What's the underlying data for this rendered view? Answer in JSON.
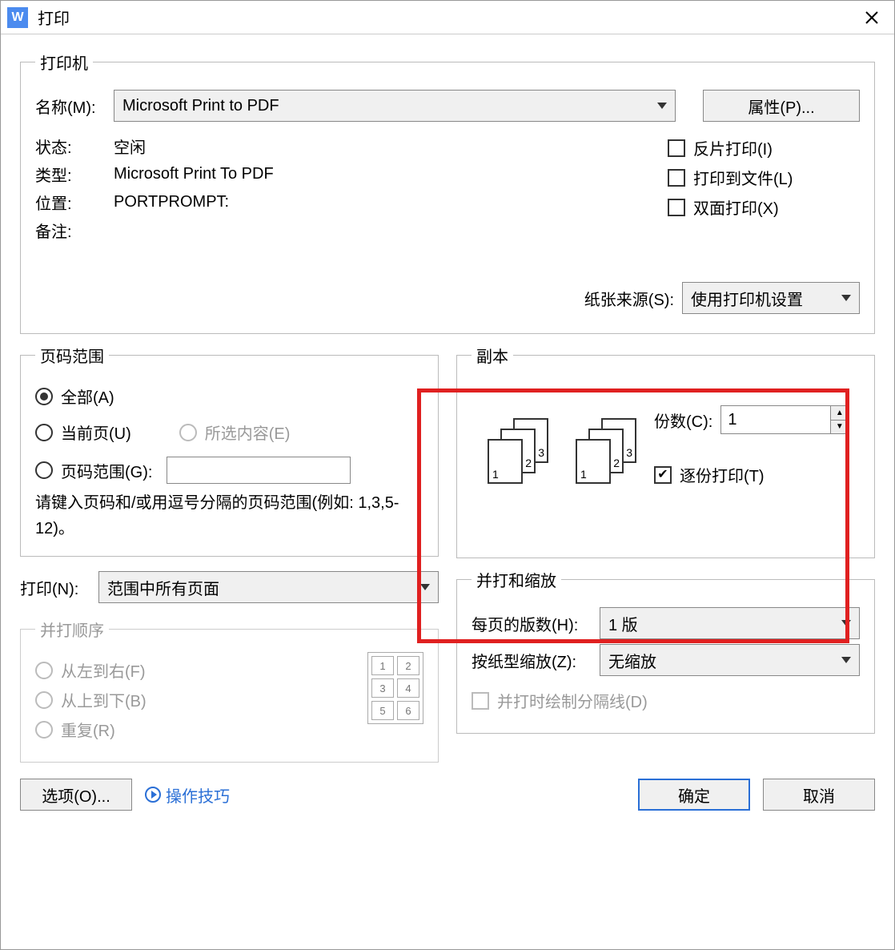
{
  "title": "打印",
  "printer": {
    "legend": "打印机",
    "name_label": "名称(M):",
    "name_value": "Microsoft Print to PDF",
    "properties_btn": "属性(P)...",
    "status_label": "状态:",
    "status_value": "空闲",
    "type_label": "类型:",
    "type_value": "Microsoft Print To PDF",
    "where_label": "位置:",
    "where_value": "PORTPROMPT:",
    "comment_label": "备注:",
    "comment_value": "",
    "mirror_cb": "反片打印(I)",
    "tofile_cb": "打印到文件(L)",
    "duplex_cb": "双面打印(X)",
    "paper_source_label": "纸张来源(S):",
    "paper_source_value": "使用打印机设置"
  },
  "range": {
    "legend": "页码范围",
    "all": "全部(A)",
    "current": "当前页(U)",
    "selection": "所选内容(E)",
    "pages": "页码范围(G):",
    "pages_value": "",
    "hint": "请键入页码和/或用逗号分隔的页码范围(例如: 1,3,5-12)。",
    "print_label": "打印(N):",
    "print_value": "范围中所有页面"
  },
  "order": {
    "legend": "并打顺序",
    "lr": "从左到右(F)",
    "tb": "从上到下(B)",
    "repeat": "重复(R)",
    "grid": [
      "1",
      "2",
      "3",
      "4",
      "5",
      "6"
    ]
  },
  "copies": {
    "legend": "副本",
    "count_label": "份数(C):",
    "count_value": "1",
    "collate": "逐份打印(T)"
  },
  "zoom": {
    "legend": "并打和缩放",
    "pps_label": "每页的版数(H):",
    "pps_value": "1 版",
    "scale_label": "按纸型缩放(Z):",
    "scale_value": "无缩放",
    "sep_cb": "并打时绘制分隔线(D)"
  },
  "footer": {
    "options_btn": "选项(O)...",
    "tips_link": "操作技巧",
    "ok_btn": "确定",
    "cancel_btn": "取消"
  }
}
